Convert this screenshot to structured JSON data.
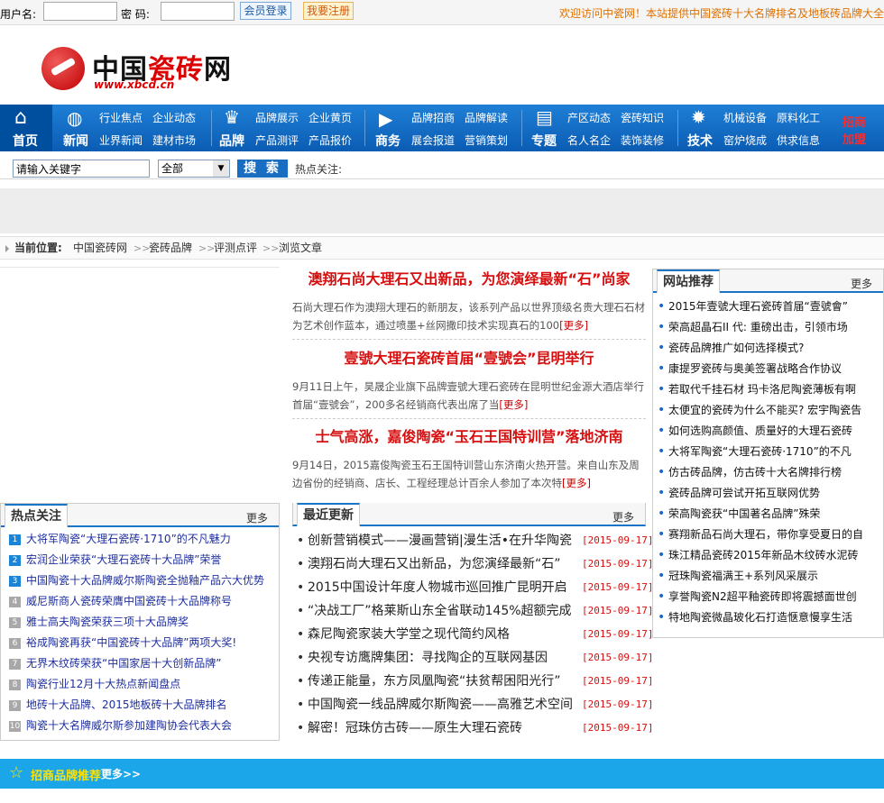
{
  "topbar": {
    "username_label": "用户名:",
    "password_label": "密  码:",
    "login_button": "会员登录",
    "register_button": "我要注册",
    "welcome": "欢迎访问中瓷网！本站提供中国瓷砖十大名牌排名及地板砖品牌大全"
  },
  "logo": {
    "name_a": "中国",
    "name_b": "瓷砖",
    "name_c": "网",
    "url": "www.xbcd.cn"
  },
  "nav": {
    "home": "首页",
    "home_icon": "house-icon",
    "news": "新闻",
    "news_icon": "globe-icon",
    "news_links": [
      "行业焦点",
      "企业动态",
      "业界新闻",
      "建材市场"
    ],
    "brand": "品牌",
    "brand_icon": "crown-icon",
    "brand_links": [
      "品牌展示",
      "企业黄页",
      "产品测评",
      "产品报价"
    ],
    "business": "商务",
    "business_icon": "flag-icon",
    "business_links": [
      "品牌招商",
      "品牌解读",
      "展会报道",
      "营销策划"
    ],
    "special": "专题",
    "special_icon": "document-icon",
    "special_links": [
      "产区动态",
      "瓷砖知识",
      "名人名企",
      "装饰装修"
    ],
    "tech": "技术",
    "tech_icon": "gear-icon",
    "tech_links": [
      "机械设备",
      "原料化工",
      "窑炉烧成",
      "供求信息"
    ],
    "join_a": "招商",
    "join_b": "加盟"
  },
  "search": {
    "keyword_value": "请输入关键字",
    "category_value": "全部",
    "button": "搜 索",
    "hot_label": "热点关注:"
  },
  "breadcrumb": {
    "current_label": "当前位置:",
    "items": [
      "中国瓷砖网",
      "瓷砖品牌",
      "评测点评",
      "浏览文章"
    ],
    "separator": ">>"
  },
  "headlines": [
    {
      "title": "澳翔石尚大理石又出新品，为您演绎最新“石”尚家",
      "summary": "石尚大理石作为澳翔大理石的新朋友，该系列产品以世界顶级名贵大理石石材为艺术创作蓝本，通过喷墨+丝网撒印技术实现真石的100",
      "more": "[更多]"
    },
    {
      "title": "壹號大理石瓷砖首届“壹號会”昆明举行",
      "summary": "9月11日上午，昊晟企业旗下品牌壹號大理石瓷砖在昆明世纪金源大酒店举行首届“壹號会”，200多名经销商代表出席了当",
      "more": "[更多]"
    },
    {
      "title": "士气高涨，嘉俊陶瓷“玉石王国特训营”落地济南",
      "summary": "9月14日，2015嘉俊陶瓷玉石王国特训营山东济南火热开营。来自山东及周边省份的经销商、店长、工程经理总计百余人参加了本次特",
      "more": "[更多]"
    }
  ],
  "hot_focus": {
    "title": "热点关注",
    "more": "更多",
    "items": [
      {
        "num": "1",
        "text": "大将军陶瓷“大理石瓷砖·1710”的不凡魅力"
      },
      {
        "num": "2",
        "text": "宏润企业荣获“大理石瓷砖十大品牌”荣誉"
      },
      {
        "num": "3",
        "text": "中国陶瓷十大品牌威尔斯陶瓷全抛釉产品六大优势"
      },
      {
        "num": "4",
        "text": "威尼斯商人瓷砖荣膺中国瓷砖十大品牌称号"
      },
      {
        "num": "5",
        "text": "雅士高夫陶瓷荣获三项十大品牌奖"
      },
      {
        "num": "6",
        "text": "裕成陶瓷再获“中国瓷砖十大品牌”两项大奖!"
      },
      {
        "num": "7",
        "text": "无界木纹砖荣获“中国家居十大创新品牌”"
      },
      {
        "num": "8",
        "text": "陶瓷行业12月十大热点新闻盘点"
      },
      {
        "num": "9",
        "text": "地砖十大品牌、2015地板砖十大品牌排名"
      },
      {
        "num": "10",
        "text": "陶瓷十大名牌威尔斯参加建陶协会代表大会"
      }
    ]
  },
  "latest": {
    "title": "最近更新",
    "more": "更多",
    "items": [
      {
        "text": "创新营销模式——漫画营销|漫生活•在升华陶瓷",
        "date": "[2015-09-17]"
      },
      {
        "text": "澳翔石尚大理石又出新品，为您演绎最新“石”",
        "date": "[2015-09-17]"
      },
      {
        "text": "2015中国设计年度人物城市巡回推广昆明开启",
        "date": "[2015-09-17]"
      },
      {
        "text": "“决战工厂”格莱斯山东全省联动145%超额完成",
        "date": "[2015-09-17]"
      },
      {
        "text": "森尼陶瓷家装大学堂之现代简约风格",
        "date": "[2015-09-17]"
      },
      {
        "text": "央视专访鹰牌集团：寻找陶企的互联网基因",
        "date": "[2015-09-17]"
      },
      {
        "text": "传递正能量，东方凤凰陶瓷“扶贫帮困阳光行”",
        "date": "[2015-09-17]"
      },
      {
        "text": "中国陶瓷一线品牌威尔斯陶瓷——高雅艺术空间",
        "date": "[2015-09-17]"
      },
      {
        "text": "解密！冠珠仿古砖——原生大理石瓷砖",
        "date": "[2015-09-17]"
      }
    ]
  },
  "recommend": {
    "title": "网站推荐",
    "more": "更多",
    "items": [
      "2015年壹號大理石瓷砖首届“壹號會”",
      "荣高超晶石II 代: 重磅出击，引领市场",
      "瓷砖品牌推广如何选择模式?",
      "康提罗瓷砖与奥美签署战略合作协议",
      "若取代千挂石材 玛卡洛尼陶瓷薄板有啊",
      "太便宜的瓷砖为什么不能买? 宏宇陶瓷告",
      "如何选购高颜值、质量好的大理石瓷砖",
      "大将军陶瓷“大理石瓷砖·1710”的不凡",
      "仿古砖品牌，仿古砖十大名牌排行榜",
      "瓷砖品牌可尝试开拓互联网优势",
      "荣高陶瓷获“中国著名品牌”殊荣",
      "赛翔新品石尚大理石，带你享受夏日的自",
      "珠江精品瓷砖2015年新品木纹砖水泥砖",
      "冠珠陶瓷福满王+系列风采展示",
      "享誉陶瓷N2超平釉瓷砖即将震撼面世创",
      "特地陶瓷微晶玻化石打造惬意慢享生活"
    ]
  },
  "bottom_bar": {
    "title": "招商品牌推荐",
    "more": "更多>>",
    "icon": "star-icon"
  }
}
